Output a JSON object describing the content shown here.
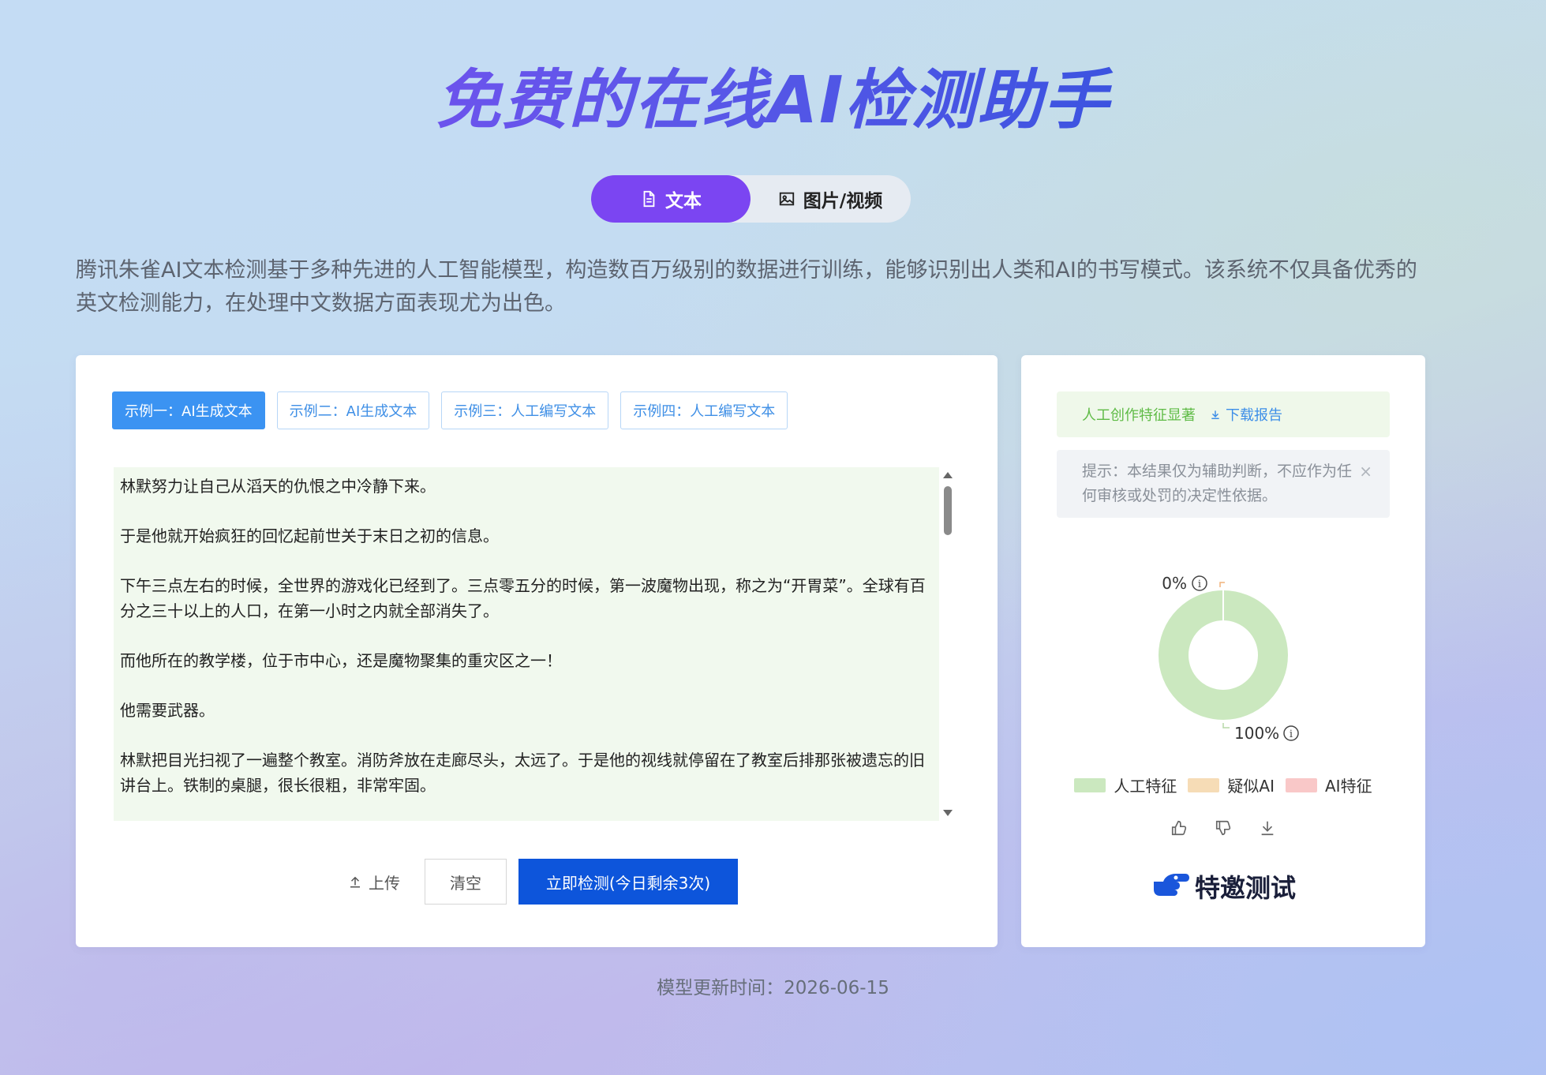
{
  "hero": {
    "title": "免费的在线AI检测助手"
  },
  "mode_tabs": [
    {
      "label": "文本",
      "icon": "document-icon",
      "active": true
    },
    {
      "label": "图片/视频",
      "icon": "image-icon",
      "active": false
    }
  ],
  "intro": "腾讯朱雀AI文本检测基于多种先进的人工智能模型，构造数百万级别的数据进行训练，能够识别出人类和AI的书写模式。该系统不仅具备优秀的英文检测能力，在处理中文数据方面表现尤为出色。",
  "examples": [
    {
      "label": "示例一：AI生成文本",
      "active": true
    },
    {
      "label": "示例二：AI生成文本",
      "active": false
    },
    {
      "label": "示例三：人工编写文本",
      "active": false
    },
    {
      "label": "示例四：人工编写文本",
      "active": false
    }
  ],
  "input_text": [
    "林默努力让自己从滔天的仇恨之中冷静下来。",
    "于是他就开始疯狂的回忆起前世关于末日之初的信息。",
    "下午三点左右的时候，全世界的游戏化已经到了。三点零五分的时候，第一波魔物出现，称之为“开胃菜”。全球有百分之三十以上的人口，在第一小时之内就全部消失了。",
    "而他所在的教学楼，位于市中心，还是魔物聚集的重灾区之一！",
    "他需要武器。",
    "林默把目光扫视了一遍整个教室。消防斧放在走廊尽头，太远了。于是他的视线就停留在了教室后排那张被遗忘的旧讲台上。铁制的桌腿，很长很粗，非常牢固。"
  ],
  "actions": {
    "upload": "上传",
    "clear": "清空",
    "detect": "立即检测(今日剩余3次)"
  },
  "result": {
    "verdict": "人工创作特征显著",
    "download": "下载报告",
    "tip": "提示：本结果仅为辅助判断，不应作为任何审核或处罚的决定性依据。",
    "tip_close": "×"
  },
  "chart_data": {
    "type": "pie",
    "labels": [
      "人工特征",
      "疑似AI",
      "AI特征"
    ],
    "values": [
      100,
      0,
      0
    ],
    "colors": [
      "#cbe8bf",
      "#f6dcb6",
      "#f9c8c8"
    ],
    "data_labels": [
      "100%",
      "0%"
    ],
    "legend": "bottom"
  },
  "invite": "特邀测试",
  "footer": {
    "model_update": "模型更新时间：2026-06-15"
  }
}
